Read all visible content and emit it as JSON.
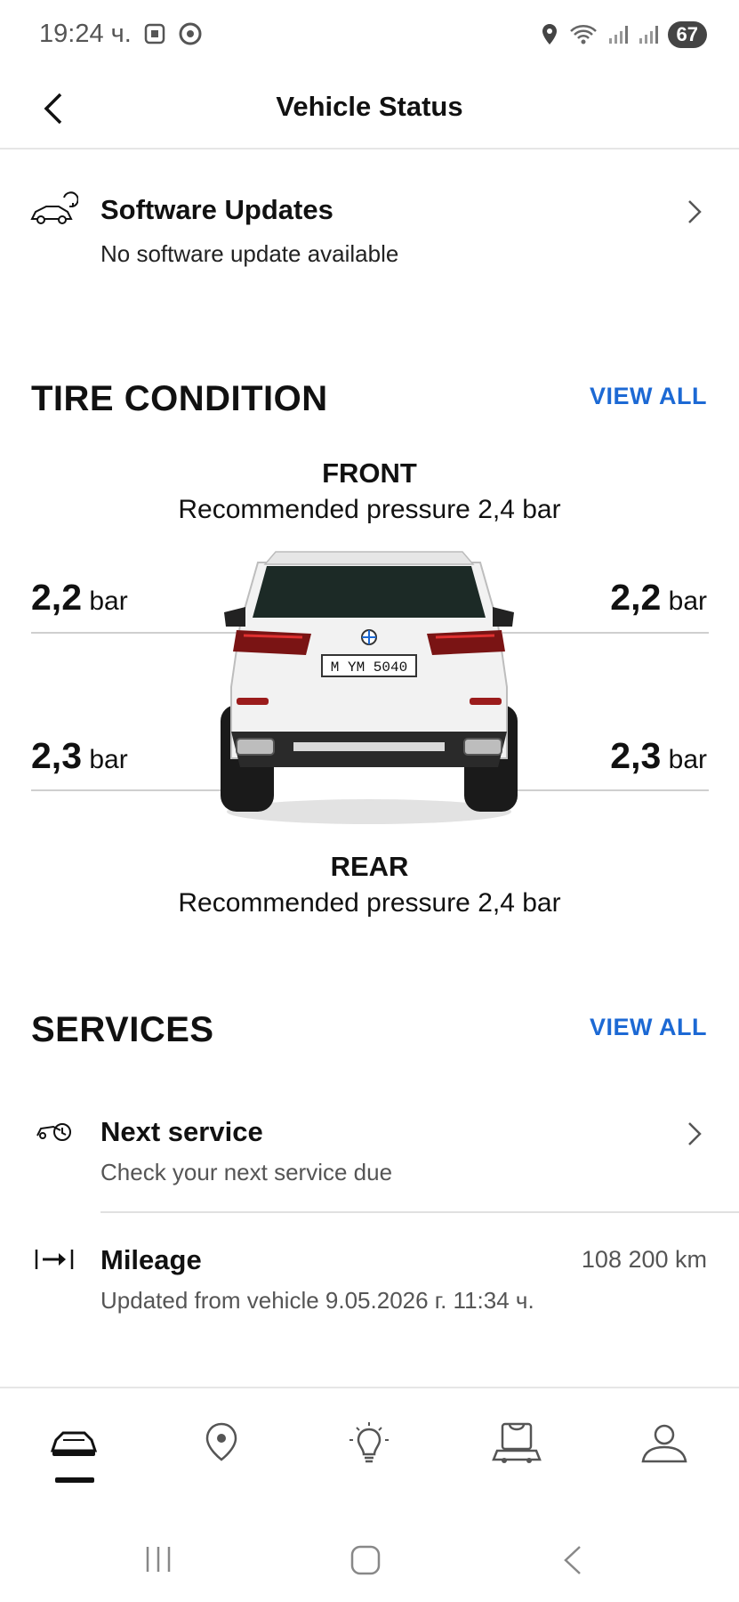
{
  "status_bar": {
    "time": "19:24 ч.",
    "battery": "67"
  },
  "header": {
    "title": "Vehicle Status"
  },
  "software": {
    "title": "Software Updates",
    "subtitle": "No software update available"
  },
  "tire_condition": {
    "title": "TIRE CONDITION",
    "view_all": "VIEW ALL",
    "front_label": "FRONT",
    "front_recommended": "Recommended pressure 2,4 bar",
    "rear_label": "REAR",
    "rear_recommended": "Recommended pressure 2,4 bar",
    "front_left": "2,2",
    "front_right": "2,2",
    "rear_left": "2,3",
    "rear_right": "2,3",
    "unit": "bar",
    "plate": "M YM 5040"
  },
  "services": {
    "title": "SERVICES",
    "view_all": "VIEW ALL",
    "next_service_title": "Next service",
    "next_service_sub": "Check your next service due",
    "mileage_title": "Mileage",
    "mileage_value": "108 200 km",
    "mileage_sub": "Updated from vehicle 9.05.2026 г. 11:34 ч."
  },
  "icons": {
    "back": "chevron-left-icon",
    "software": "car-update-icon",
    "next_service": "service-icon",
    "mileage": "mileage-icon",
    "nav": [
      "car-icon",
      "map-pin-icon",
      "bulb-icon",
      "shop-car-icon",
      "profile-icon"
    ]
  },
  "colors": {
    "accent": "#1c69d4"
  }
}
